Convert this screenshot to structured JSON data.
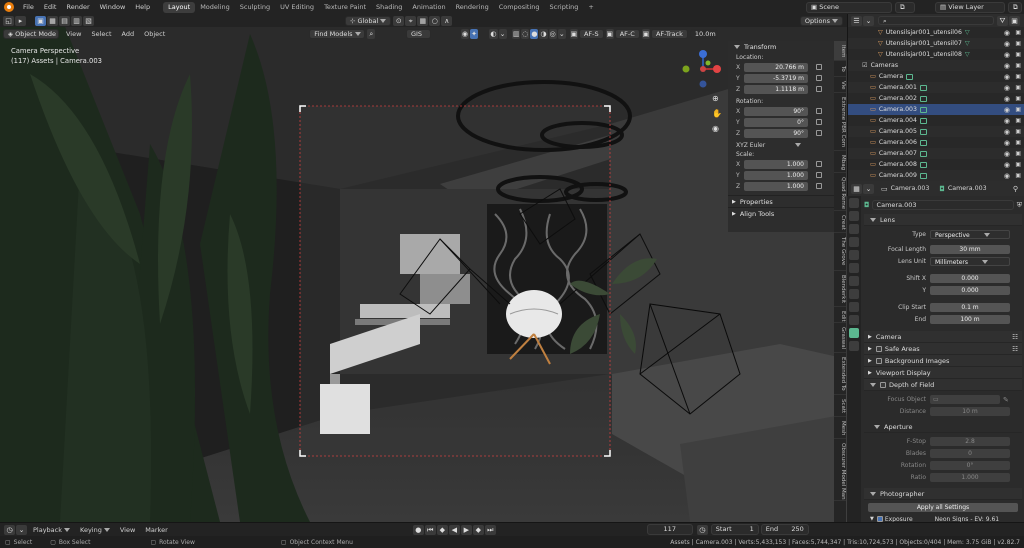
{
  "topbar": {
    "menus": [
      "File",
      "Edit",
      "Render",
      "Window",
      "Help"
    ],
    "workspaces": [
      "Layout",
      "Modeling",
      "Sculpting",
      "UV Editing",
      "Texture Paint",
      "Shading",
      "Animation",
      "Rendering",
      "Compositing",
      "Scripting"
    ],
    "active_workspace": "Layout",
    "scene_label": "Scene",
    "view_layer_label": "View Layer"
  },
  "vp_header": {
    "orientation": "Global",
    "options": "Options"
  },
  "vp_header2": {
    "mode": "Object Mode",
    "menus": [
      "View",
      "Select",
      "Add",
      "Object"
    ],
    "find_models": "Find Models",
    "gis": "GIS",
    "af_s": "AF-S",
    "af_c": "AF-C",
    "af_track": "AF-Track",
    "focal": "10.0m"
  },
  "viewport": {
    "title": "Camera Perspective",
    "subtitle": "(117) Assets | Camera.003"
  },
  "npanel": {
    "transform_title": "Transform",
    "location_label": "Location:",
    "location": {
      "x": "20.766 m",
      "y": "-5.3719 m",
      "z": "1.1118 m"
    },
    "rotation_label": "Rotation:",
    "rotation": {
      "x": "90°",
      "y": "0°",
      "z": "90°"
    },
    "rotation_mode": "XYZ Euler",
    "scale_label": "Scale:",
    "scale": {
      "x": "1.000",
      "y": "1.000",
      "z": "1.000"
    },
    "axis": {
      "x": "X",
      "y": "Y",
      "z": "Z"
    },
    "properties": "Properties",
    "align_tools": "Align Tools"
  },
  "ntabs": [
    "Item",
    "To",
    "Vie",
    "Extreme PBR Com",
    "Mbag",
    "Quad Reme",
    "Creat",
    "The Grove",
    "Blenderkit",
    "Edit",
    "Graswal",
    "Extended To",
    "Scatt",
    "Mesh",
    "Obscurer Model Manag"
  ],
  "outliner": {
    "rows": [
      {
        "name": "Utensilsjar001_utensil06",
        "indent": 3,
        "type": "mesh"
      },
      {
        "name": "Utensilsjar001_utensil07",
        "indent": 3,
        "type": "mesh"
      },
      {
        "name": "Utensilsjar001_utensil08",
        "indent": 3,
        "type": "mesh"
      },
      {
        "name": "Cameras",
        "indent": 1,
        "type": "collection"
      },
      {
        "name": "Camera",
        "indent": 2,
        "type": "camera"
      },
      {
        "name": "Camera.001",
        "indent": 2,
        "type": "camera"
      },
      {
        "name": "Camera.002",
        "indent": 2,
        "type": "camera"
      },
      {
        "name": "Camera.003",
        "indent": 2,
        "type": "camera",
        "selected": true
      },
      {
        "name": "Camera.004",
        "indent": 2,
        "type": "camera"
      },
      {
        "name": "Camera.005",
        "indent": 2,
        "type": "camera"
      },
      {
        "name": "Camera.006",
        "indent": 2,
        "type": "camera"
      },
      {
        "name": "Camera.007",
        "indent": 2,
        "type": "camera"
      },
      {
        "name": "Camera.008",
        "indent": 2,
        "type": "camera"
      },
      {
        "name": "Camera.009",
        "indent": 2,
        "type": "camera"
      }
    ]
  },
  "props": {
    "object_name": "Camera.003",
    "data_name": "Camera.003",
    "camera_field": "Camera.003",
    "lens_section": "Lens",
    "type_label": "Type",
    "type_value": "Perspective",
    "focal_length_label": "Focal Length",
    "focal_length_value": "30 mm",
    "lens_unit_label": "Lens Unit",
    "lens_unit_value": "Millimeters",
    "shift_x_label": "Shift X",
    "shift_x_value": "0.000",
    "shift_y_label": "Y",
    "shift_y_value": "0.000",
    "clip_start_label": "Clip Start",
    "clip_start_value": "0.1 m",
    "clip_end_label": "End",
    "clip_end_value": "100 m",
    "camera_section": "Camera",
    "safe_areas": "Safe Areas",
    "background_images": "Background Images",
    "viewport_display": "Viewport Display",
    "dof_section": "Depth of Field",
    "focus_object_label": "Focus Object",
    "distance_label": "Distance",
    "distance_value": "10 m",
    "aperture_section": "Aperture",
    "fstop_label": "F-Stop",
    "fstop_value": "2.8",
    "blades_label": "Blades",
    "blades_value": "0",
    "rotation_label": "Rotation",
    "rotation_value": "0°",
    "ratio_label": "Ratio",
    "ratio_value": "1.000",
    "photographer_section": "Photographer",
    "apply_all": "Apply all Settings",
    "exposure_label": "Exposure",
    "exposure_value": "Neon Signs - EV: 9.61"
  },
  "timeline": {
    "playback": "Playback",
    "keying": "Keying",
    "view": "View",
    "marker": "Marker",
    "frame": "117",
    "start_label": "Start",
    "start_value": "1",
    "end_label": "End",
    "end_value": "250"
  },
  "statusbar": {
    "select": "Select",
    "box_select": "Box Select",
    "rotate_view": "Rotate View",
    "context_menu": "Object Context Menu",
    "stats": "Assets | Camera.003 | Verts:5,433,153 | Faces:5,744,347 | Tris:10,724,573 | Objects:0/404 | Mem: 3.75 GiB | v2.82.7"
  },
  "colors": {
    "accent": "#4772b3",
    "selection": "#334d80",
    "camera_icon": "#5cb890",
    "logo": "#e87d0d",
    "frame_border": "#ffffff",
    "frame_dash": "#d04040"
  }
}
